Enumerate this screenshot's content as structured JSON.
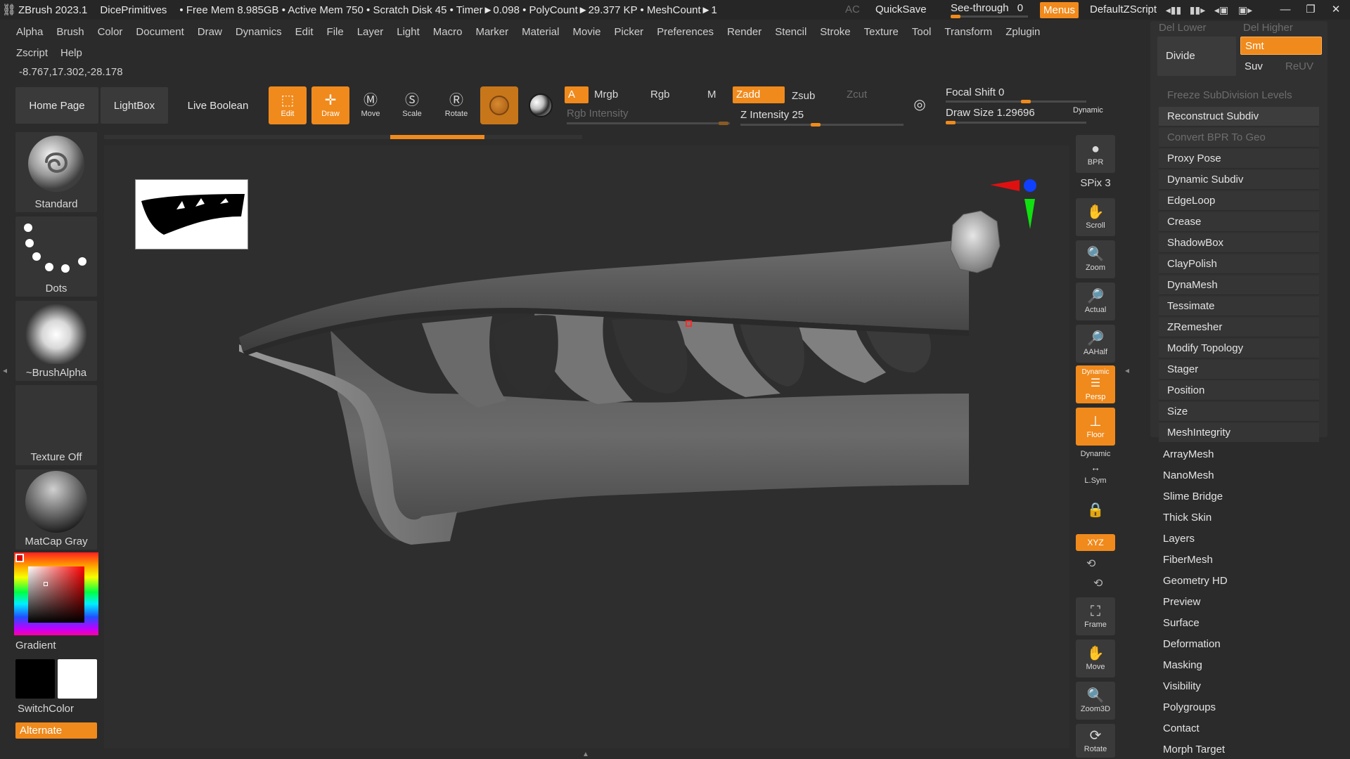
{
  "titlebar": {
    "app_name": "ZBrush 2023.1",
    "document": "DicePrimitives",
    "stats": "• Free Mem 8.985GB • Active Mem 750 • Scratch Disk 45 • Timer►0.098 • PolyCount►29.377 KP • MeshCount►1",
    "ac": "AC",
    "quicksave": "QuickSave",
    "see_through_label": "See-through",
    "see_through_value": "0",
    "menus": "Menus",
    "default_zscript": "DefaultZScript"
  },
  "menubar": [
    "Alpha",
    "Brush",
    "Color",
    "Document",
    "Draw",
    "Dynamics",
    "Edit",
    "File",
    "Layer",
    "Light",
    "Macro",
    "Marker",
    "Material",
    "Movie",
    "Picker",
    "Preferences",
    "Render",
    "Stencil",
    "Stroke",
    "Texture",
    "Tool",
    "Transform",
    "Zplugin"
  ],
  "menubar2": [
    "Zscript",
    "Help"
  ],
  "coords": "-8.767,17.302,-28.178",
  "shelf": {
    "home_page": "Home Page",
    "lightbox": "LightBox",
    "live_boolean": "Live Boolean",
    "edit": "Edit",
    "draw": "Draw",
    "move": "Move",
    "scale": "Scale",
    "rotate": "Rotate",
    "a": "A",
    "mrgb": "Mrgb",
    "rgb": "Rgb",
    "m": "M",
    "zadd": "Zadd",
    "zsub": "Zsub",
    "zcut": "Zcut",
    "rgb_intensity": "Rgb Intensity",
    "z_intensity": "Z Intensity 25",
    "focal_shift": "Focal Shift 0",
    "draw_size": "Draw Size 1.29696",
    "dynamic": "Dynamic"
  },
  "left": {
    "brush": "Standard",
    "stroke": "Dots",
    "alpha": "~BrushAlpha",
    "texture": "Texture Off",
    "material": "MatCap Gray",
    "gradient": "Gradient",
    "switch_color": "SwitchColor",
    "alternate": "Alternate"
  },
  "right_shelf": {
    "bpr": "BPR",
    "spix": "SPix 3",
    "scroll": "Scroll",
    "zoom": "Zoom",
    "actual": "Actual",
    "aahalf": "AAHalf",
    "dynamic": "Dynamic",
    "persp": "Persp",
    "floor": "Floor",
    "lsym": "L.Sym",
    "xyz": "XYZ",
    "frame": "Frame",
    "move": "Move",
    "zoom3d": "Zoom3D",
    "rotate": "Rotate"
  },
  "panel": {
    "del_lower": "Del Lower",
    "del_higher": "Del Higher",
    "divide": "Divide",
    "smt": "Smt",
    "suv": "Suv",
    "reuv": "ReUV",
    "freeze": "Freeze SubDivision Levels",
    "reconstruct": "Reconstruct Subdiv",
    "convert_bpr": "Convert BPR To Geo",
    "items": [
      "Proxy Pose",
      "Dynamic Subdiv",
      "EdgeLoop",
      "Crease",
      "ShadowBox",
      "ClayPolish",
      "DynaMesh",
      "Tessimate",
      "ZRemesher",
      "Modify Topology",
      "Stager",
      "Position",
      "Size",
      "MeshIntegrity"
    ],
    "subpalettes": [
      "ArrayMesh",
      "NanoMesh",
      "Slime Bridge",
      "Thick Skin",
      "Layers",
      "FiberMesh",
      "Geometry HD",
      "Preview",
      "Surface",
      "Deformation",
      "Masking",
      "Visibility",
      "Polygroups",
      "Contact",
      "Morph Target"
    ]
  },
  "colors": {
    "accent": "#f08a1c",
    "background": "#2b2b2b",
    "panel": "#313131",
    "viewport": "#2e2e2e"
  }
}
